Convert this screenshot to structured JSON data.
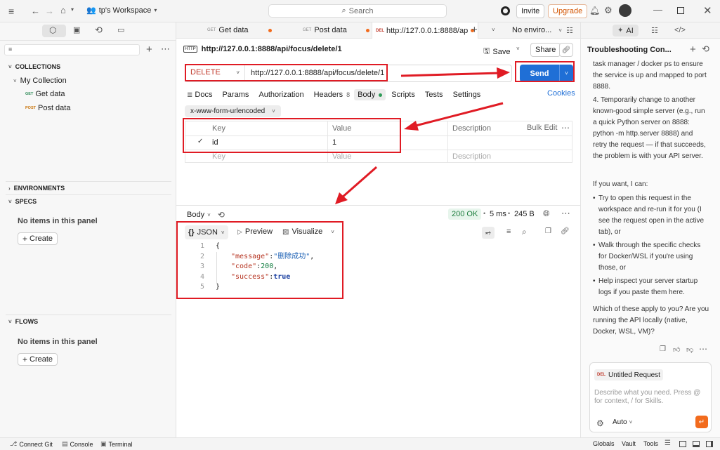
{
  "topbar": {
    "workspace": "tp's Workspace",
    "search_placeholder": "Search",
    "invite": "Invite",
    "upgrade": "Upgrade"
  },
  "tabs": [
    {
      "method": "GET",
      "label": "Get data"
    },
    {
      "method": "GET",
      "label": "Post data"
    },
    {
      "method": "DEL",
      "label": "http://127.0.0.1:8888/ap"
    }
  ],
  "env_select": "No enviro...",
  "ai_tab": "AI",
  "sidebar": {
    "collections": "COLLECTIONS",
    "collection_name": "My Collection",
    "requests": [
      {
        "method": "GET",
        "label": "Get data"
      },
      {
        "method": "POST",
        "label": "Post data"
      }
    ],
    "environments": "ENVIRONMENTS",
    "specs": "SPECS",
    "no_items": "No items in this panel",
    "create": "Create",
    "flows": "FLOWS",
    "no_items_flows": "No items in this panel",
    "create_flows": "Create"
  },
  "request": {
    "badge": "HTTP",
    "title": "http://127.0.0.1:8888/api/focus/delete/1",
    "save": "Save",
    "share": "Share",
    "method": "DELETE",
    "url": "http://127.0.0.1:8888/api/focus/delete/1",
    "send": "Send",
    "subtabs": [
      "Docs",
      "Params",
      "Authorization",
      "Headers",
      "Body",
      "Scripts",
      "Tests",
      "Settings"
    ],
    "headers_count": "8",
    "cookies": "Cookies",
    "body_type": "x-www-form-urlencoded",
    "table_headers": [
      "Key",
      "Value",
      "Description"
    ],
    "bulk_edit": "Bulk Edit",
    "rows": [
      {
        "key": "id",
        "value": "1",
        "description": ""
      }
    ],
    "key_placeholder": "Key",
    "value_placeholder": "Value",
    "desc_placeholder": "Description"
  },
  "response": {
    "body_label": "Body",
    "status": "200 OK",
    "time": "5 ms",
    "size": "245 B",
    "format": "JSON",
    "preview": "Preview",
    "visualize": "Visualize",
    "lines": [
      {
        "n": "1",
        "t": "{"
      },
      {
        "n": "2",
        "k": "\"message\"",
        "v": "\"删除成功\"",
        "c": ","
      },
      {
        "n": "3",
        "k": "\"code\"",
        "v": "200",
        "c": ","
      },
      {
        "n": "4",
        "k": "\"success\"",
        "v": "true",
        "c": ""
      },
      {
        "n": "5",
        "t": "}"
      }
    ]
  },
  "chat": {
    "title": "Troubleshooting Con...",
    "p1": "task manager / docker ps to ensure the service is up and mapped to port 8888.",
    "p2": "4. Temporarily change to another known-good simple server (e.g., run a quick Python server on 8888: python -m http.server 8888) and retry the request — if that succeeds, the problem is with your API server.",
    "p3": "If you want, I can:",
    "bullets": [
      "Try to open this request in the workspace and re-run it for you (I see the request open in the active tab), or",
      "Walk through the specific checks for Docker/WSL if you're using those, or",
      "Help inspect your server startup logs if you paste them here."
    ],
    "p4": "Which of these apply to you? Are you running the API locally (native, Docker, WSL, VM)?",
    "context_method": "DEL",
    "context_label": "Untitled Request",
    "input_placeholder": "Describe what you need. Press @ for context, / for Skills.",
    "mode": "Auto"
  },
  "statusbar": {
    "connect_git": "Connect Git",
    "console": "Console",
    "terminal": "Terminal",
    "globals": "Globals",
    "vault": "Vault",
    "tools": "Tools"
  },
  "colors": {
    "accent": "#1f6fd6",
    "alert": "#e01b24",
    "upgrade": "#d35400",
    "ok_bg": "#e7f5ec",
    "ok_text": "#1e7e3f"
  }
}
